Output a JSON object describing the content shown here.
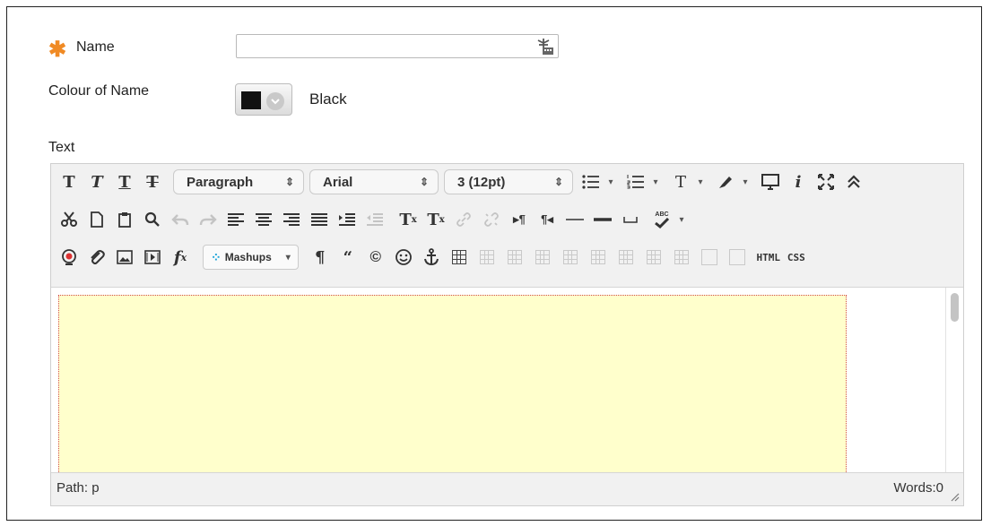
{
  "form": {
    "name_label": "Name",
    "name_value": "",
    "colour_label": "Colour of Name",
    "colour_value_name": "Black",
    "colour_swatch": "#111111",
    "text_label": "Text",
    "required_color": "#f08a24"
  },
  "toolbar": {
    "row1": {
      "bold_glyph": "T",
      "italic_glyph": "T",
      "underline_glyph": "T",
      "strike_glyph": "T",
      "format_select": "Paragraph",
      "font_select": "Arial",
      "size_select": "3 (12pt)",
      "bullet_list_icon": "bullet-list-icon",
      "numbered_list_icon": "numbered-list-icon",
      "text_color_glyph": "T",
      "info_glyph": "i"
    },
    "row2": {
      "superscript_glyph": "T",
      "superscript_mark": "x",
      "subscript_glyph": "T",
      "subscript_mark": "x",
      "spellcheck_text": "ABC"
    },
    "row3": {
      "function_glyph": "f",
      "function_sub": "x",
      "mashups_label": "Mashups",
      "paragraph_mark": "¶",
      "quote_mark": "“",
      "copyright_mark": "©",
      "html_label": "HTML",
      "css_label": "CSS"
    }
  },
  "statusbar": {
    "path": "Path: p",
    "words": "Words:0"
  },
  "colors": {
    "content_bg": "#ffffcc",
    "toolbar_bg": "#f1f1f1"
  }
}
